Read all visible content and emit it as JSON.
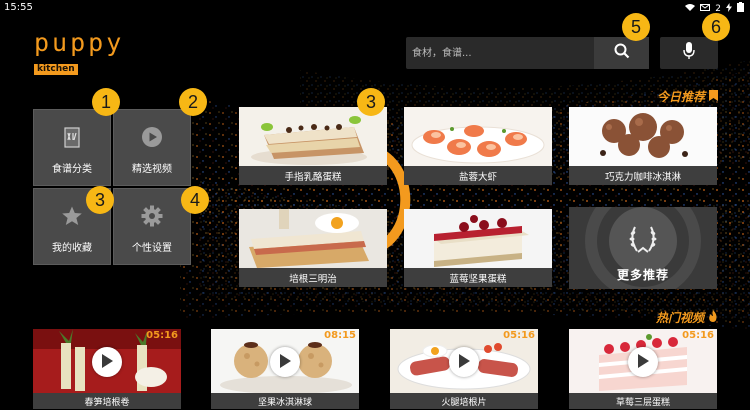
{
  "status_bar": {
    "time": "15:55",
    "notification_count": "2"
  },
  "logo": {
    "word": "puppy",
    "badge": "kitchen"
  },
  "search": {
    "placeholder": "食材，食谱...",
    "icon": "search-icon"
  },
  "mic": {
    "icon": "microphone-icon"
  },
  "callouts": [
    "1",
    "2",
    "3",
    "4",
    "5",
    "6"
  ],
  "menu": [
    {
      "label": "食谱分类",
      "icon": "recipe-category-icon"
    },
    {
      "label": "精选视频",
      "icon": "play-circle-icon"
    },
    {
      "label": "我的收藏",
      "icon": "star-icon"
    },
    {
      "label": "个性设置",
      "icon": "gear-icon"
    }
  ],
  "today": {
    "title": "今日推荐",
    "icon": "bookmark-icon",
    "cards": [
      {
        "label": "手指乳酪蛋糕"
      },
      {
        "label": "盐蓉大虾"
      },
      {
        "label": "巧克力咖啡冰淇淋"
      },
      {
        "label": "培根三明治"
      },
      {
        "label": "蓝莓坚果蛋糕"
      }
    ],
    "more_label": "更多推荐"
  },
  "hot": {
    "title": "热门视频",
    "icon": "fire-icon",
    "videos": [
      {
        "label": "春笋培根卷",
        "duration": "05:16"
      },
      {
        "label": "坚果冰淇淋球",
        "duration": "08:15"
      },
      {
        "label": "火腿培根片",
        "duration": "05:16"
      },
      {
        "label": "草莓三层蛋糕",
        "duration": "05:16"
      }
    ]
  },
  "colors": {
    "accent": "#f39a1e",
    "callout": "#f7b715",
    "tile": "#4a4a4a"
  }
}
